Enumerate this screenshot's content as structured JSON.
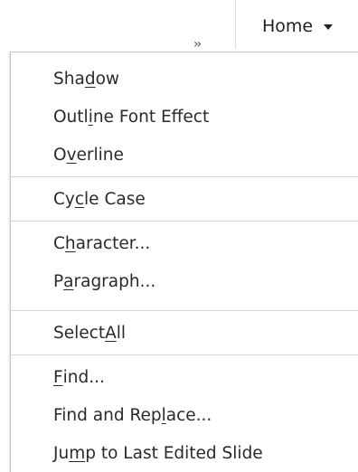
{
  "toolbar": {
    "tab_label": "Home"
  },
  "menu": {
    "items": [
      {
        "pre": "Sha",
        "mn": "d",
        "post": "ow"
      },
      {
        "pre": "Outl",
        "mn": "i",
        "post": "ne Font Effect"
      },
      {
        "pre": "O",
        "mn": "v",
        "post": "erline"
      },
      {
        "pre": "Cy",
        "mn": "c",
        "post": "le Case"
      },
      {
        "pre": "C",
        "mn": "h",
        "post": "aracter..."
      },
      {
        "pre": "P",
        "mn": "a",
        "post": "ragraph..."
      },
      {
        "pre": "Select ",
        "mn": "A",
        "post": "ll"
      },
      {
        "pre": "",
        "mn": "F",
        "post": "ind..."
      },
      {
        "pre": "Find and Rep",
        "mn": "l",
        "post": "ace..."
      },
      {
        "pre": "Ju",
        "mn": "m",
        "post": "p to Last Edited Slide"
      }
    ]
  }
}
